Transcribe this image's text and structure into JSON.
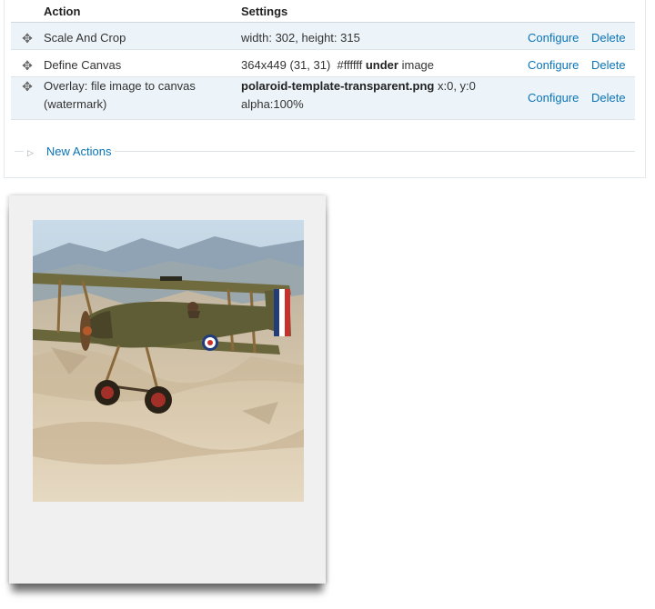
{
  "table": {
    "headers": {
      "action": "Action",
      "settings": "Settings"
    },
    "rows": [
      {
        "handle_icon": "drag-handle-icon",
        "action": "Scale And Crop",
        "settings": "width: 302, height: 315",
        "configure": "Configure",
        "delete": "Delete"
      },
      {
        "handle_icon": "drag-handle-icon",
        "action": "Define Canvas",
        "settings_a": "364x449 (31, 31)  #ffffff ",
        "settings_bold": "under",
        "settings_b": " image",
        "configure": "Configure",
        "delete": "Delete"
      },
      {
        "handle_icon": "drag-handle-icon",
        "action_line1": "Overlay: file image to canvas",
        "action_line2": "(watermark)",
        "settings_bold": "polaroid-template-transparent.png",
        "settings_a": " x:0, y:0",
        "settings_line2": "alpha:100%",
        "configure": "Configure",
        "delete": "Delete"
      }
    ]
  },
  "new_actions": {
    "label": "New Actions",
    "icon": "triangle-right-icon"
  },
  "preview": {
    "description_icon": "biplane-photo",
    "frame_color": "#f0f0f0"
  },
  "colors": {
    "link": "#0a74b8",
    "row_highlight": "#edf4f9",
    "border": "#dde4e8"
  }
}
